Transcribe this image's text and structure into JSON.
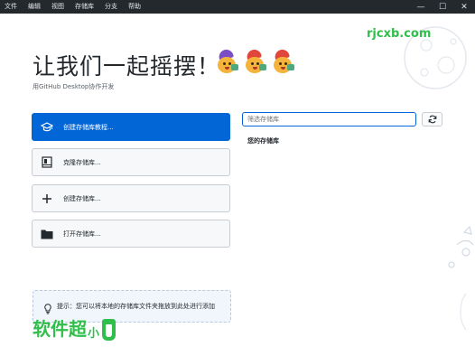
{
  "menu": {
    "items": [
      "文件",
      "编辑",
      "视图",
      "存储库",
      "分支",
      "帮助"
    ]
  },
  "window_controls": {
    "minimize": "—",
    "maximize": "☐",
    "close": "✕"
  },
  "hero": {
    "title": "让我们一起摇摆！",
    "subtitle": "用GitHub Desktop协作开发"
  },
  "actions": [
    {
      "label": "创建存储库教程...",
      "icon": "graduation-cap-icon",
      "primary": true
    },
    {
      "label": "克隆存储库...",
      "icon": "desktop-download-icon",
      "primary": false
    },
    {
      "label": "创建存储库...",
      "icon": "plus-icon",
      "primary": false
    },
    {
      "label": "打开存储库...",
      "icon": "folder-icon",
      "primary": false
    }
  ],
  "repositories": {
    "filter_placeholder": "筛选存储库",
    "heading": "您的存储库"
  },
  "tip": {
    "label": "提示：",
    "text": "您可以将本地的存储库文件夹拖放到此处进行添加"
  },
  "watermark": {
    "url": "rjcxb.com",
    "brand": "软件超",
    "brand_small": "小"
  },
  "colors": {
    "accent": "#0366d6",
    "menubar": "#24292e",
    "watermark": "#2fbf4a"
  }
}
